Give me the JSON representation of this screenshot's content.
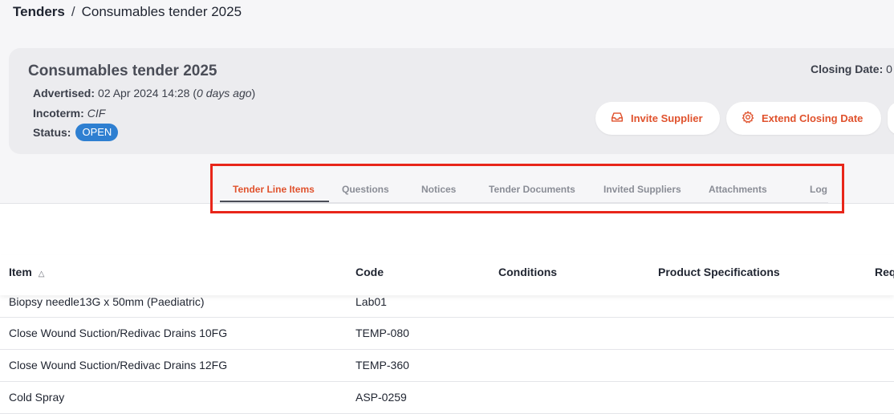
{
  "breadcrumb": {
    "root": "Tenders",
    "separator": "/",
    "current": "Consumables tender 2025"
  },
  "tender": {
    "title": "Consumables tender 2025",
    "advertised_label": "Advertised:",
    "advertised_value": "02 Apr 2024 14:28 (",
    "advertised_relative": "0 days ago",
    "advertised_close": ")",
    "incoterm_label": "Incoterm:",
    "incoterm_value": "CIF",
    "status_label": "Status:",
    "status_value": "OPEN",
    "closing_label": "Closing Date:",
    "closing_value": "0"
  },
  "actions": {
    "invite_supplier": "Invite Supplier",
    "extend_closing_date": "Extend Closing Date"
  },
  "tabs": [
    {
      "label": "Tender Line Items",
      "active": true
    },
    {
      "label": "Questions",
      "active": false
    },
    {
      "label": "Notices",
      "active": false
    },
    {
      "label": "Tender Documents",
      "active": false
    },
    {
      "label": "Invited Suppliers",
      "active": false
    },
    {
      "label": "Attachments",
      "active": false
    },
    {
      "label": "Log",
      "active": false
    }
  ],
  "table": {
    "columns": [
      "Item",
      "Code",
      "Conditions",
      "Product Specifications",
      "Req"
    ],
    "sort_indicator": "△",
    "rows": [
      {
        "item": "Biopsy needle13G x 50mm (Paediatric)",
        "code": "Lab01"
      },
      {
        "item": "Close Wound Suction/Redivac Drains 10FG",
        "code": "TEMP-080"
      },
      {
        "item": "Close Wound Suction/Redivac Drains 12FG",
        "code": "TEMP-360"
      },
      {
        "item": "Cold Spray",
        "code": "ASP-0259"
      }
    ]
  },
  "colors": {
    "accent": "#e0522d",
    "status_badge": "#2e7fd1",
    "highlight_box": "#e8261a"
  }
}
